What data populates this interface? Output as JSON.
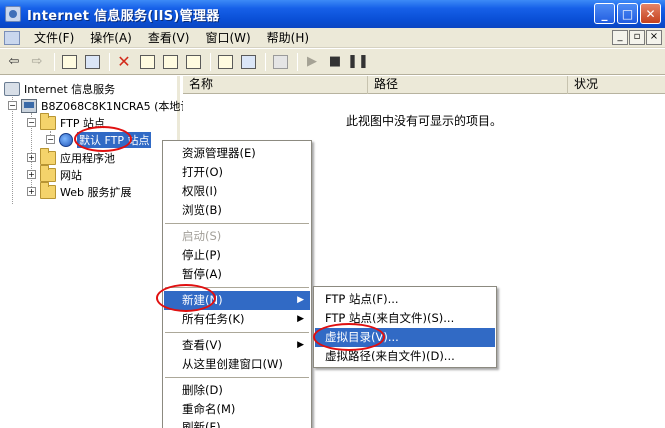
{
  "window": {
    "title": "Internet 信息服务(IIS)管理器"
  },
  "menubar": {
    "items": [
      "文件(F)",
      "操作(A)",
      "查看(V)",
      "窗口(W)",
      "帮助(H)"
    ]
  },
  "tree": {
    "root": "Internet 信息服务",
    "computer": "B8Z068C8K1NCRA5 (本地计",
    "ftp_sites": "FTP 站点",
    "default_ftp": "默认 FTP 站点",
    "app_pools": "应用程序池",
    "websites": "网站",
    "web_ext": "Web 服务扩展"
  },
  "list": {
    "columns": [
      "名称",
      "路径",
      "状况"
    ],
    "empty_message": "此视图中没有可显示的项目。"
  },
  "context_menu": {
    "items": [
      {
        "label": "资源管理器(E)",
        "disabled": false
      },
      {
        "label": "打开(O)",
        "disabled": false
      },
      {
        "label": "权限(I)",
        "disabled": false
      },
      {
        "label": "浏览(B)",
        "disabled": false
      },
      {
        "label": "启动(S)",
        "disabled": true
      },
      {
        "label": "停止(P)",
        "disabled": false
      },
      {
        "label": "暂停(A)",
        "disabled": false
      },
      {
        "label": "新建(N)",
        "disabled": false,
        "highlighted": true,
        "submenu": true
      },
      {
        "label": "所有任务(K)",
        "disabled": false,
        "submenu": true
      },
      {
        "label": "查看(V)",
        "disabled": false,
        "submenu": true
      },
      {
        "label": "从这里创建窗口(W)",
        "disabled": false
      },
      {
        "label": "删除(D)",
        "disabled": false
      },
      {
        "label": "重命名(M)",
        "disabled": false
      },
      {
        "label": "刷新(F)",
        "disabled": false
      }
    ]
  },
  "submenu": {
    "items": [
      {
        "label": "FTP 站点(F)...",
        "highlighted": false
      },
      {
        "label": "FTP 站点(来自文件)(S)...",
        "highlighted": false
      },
      {
        "label": "虚拟目录(V)...",
        "highlighted": true
      },
      {
        "label": "虚拟路径(来自文件)(D)...",
        "highlighted": false
      }
    ]
  },
  "icons": {
    "back": "back-arrow-icon",
    "forward": "forward-arrow-icon",
    "up": "up-folder-icon",
    "tree_toggle": "show-tree-icon",
    "delete": "delete-icon",
    "properties": "properties-icon",
    "refresh": "refresh-icon",
    "export": "export-list-icon",
    "help": "help-icon",
    "console": "console-icon",
    "computer": "computer-icon",
    "play": "play-icon",
    "stop": "stop-icon",
    "pause": "pause-icon"
  },
  "colors": {
    "titlebar": "#0a4fd6",
    "highlight": "#316ac5",
    "annotation": "#e01010"
  }
}
